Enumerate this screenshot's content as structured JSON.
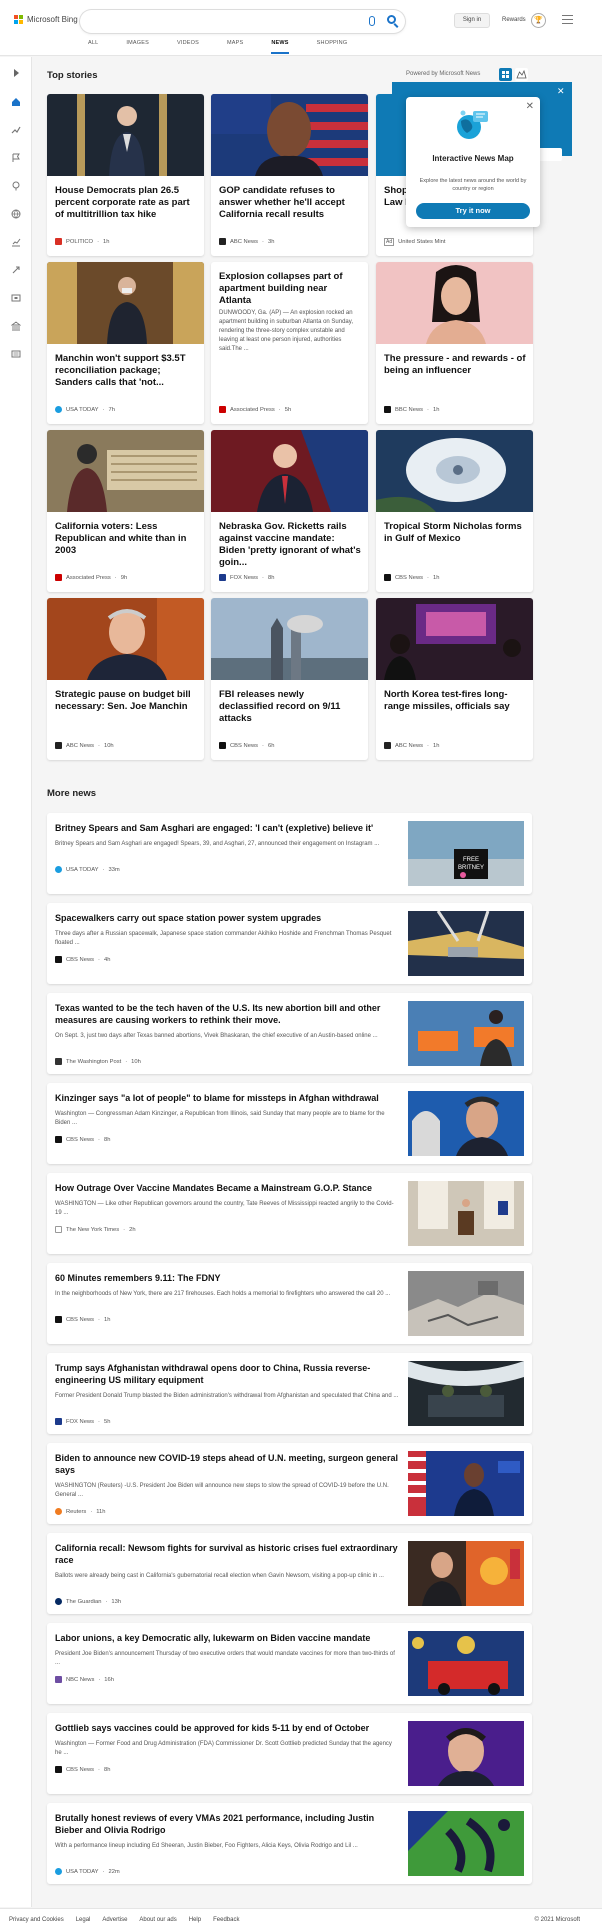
{
  "header": {
    "logo_text": "Microsoft Bing",
    "signin": "Sign in",
    "rewards": "Rewards"
  },
  "nav": [
    "ALL",
    "IMAGES",
    "VIDEOS",
    "MAPS",
    "NEWS",
    "SHOPPING"
  ],
  "nav_active": "NEWS",
  "top_stories": {
    "title": "Top stories",
    "powered": "Powered by Microsoft News",
    "cards": [
      {
        "title": "House Democrats plan 26.5 percent corporate rate as part of multitrillion tax hike",
        "source": "POLITICO",
        "time": "1h"
      },
      {
        "title": "GOP candidate refuses to answer whether he'll accept California recall results",
        "source": "ABC News",
        "time": "3h"
      },
      {
        "title": "Shop\nLaw I",
        "source": "United States Mint",
        "ad": "Ad"
      },
      {
        "title": "Manchin won't support $3.5T reconciliation package; Sanders calls that 'not...",
        "source": "USA TODAY",
        "time": "7h"
      },
      {
        "title": "Explosion collapses part of apartment building near Atlanta",
        "desc": "DUNWOODY, Ga. (AP) — An explosion rocked an apartment building in suburban Atlanta on Sunday, rendering the three-story complex unstable and leaving at least one person injured, authorities said.The ...",
        "source": "Associated Press",
        "time": "5h"
      },
      {
        "title": "The pressure - and rewards - of being an influencer",
        "source": "BBC News",
        "time": "1h"
      },
      {
        "title": "California voters: Less Republican and white than in 2003",
        "source": "Associated Press",
        "time": "9h"
      },
      {
        "title": "Nebraska Gov. Ricketts rails against vaccine mandate: Biden 'pretty ignorant of what's goin...",
        "source": "FOX News",
        "time": "8h"
      },
      {
        "title": "Tropical Storm Nicholas forms in Gulf of Mexico",
        "source": "CBS News",
        "time": "1h"
      },
      {
        "title": "Strategic pause on budget bill necessary: Sen. Joe Manchin",
        "source": "ABC News",
        "time": "10h"
      },
      {
        "title": "FBI releases newly declassified record on 9/11 attacks",
        "source": "CBS News",
        "time": "6h"
      },
      {
        "title": "North Korea test-fires long-range missiles, officials say",
        "source": "ABC News",
        "time": "1h"
      }
    ]
  },
  "popover": {
    "title": "Interactive News Map",
    "desc": "Explore the latest news around the world by country or region",
    "button": "Try it now",
    "close": "✕"
  },
  "more_news": {
    "title": "More news",
    "items": [
      {
        "title": "Britney Spears and Sam Asghari are engaged: 'I can't (expletive) believe it'",
        "desc": "Britney Spears and Sam Asghari are engaged! Spears, 39, and Asghari, 27, announced their engagement on Instagram ...",
        "source": "USA TODAY",
        "time": "33m"
      },
      {
        "title": "Spacewalkers carry out space station power system upgrades",
        "desc": "Three days after a Russian spacewalk, Japanese space station commander Akihiko Hoshide and Frenchman Thomas Pesquet floated ...",
        "source": "CBS News",
        "time": "4h"
      },
      {
        "title": "Texas wanted to be the tech haven of the U.S. Its new abortion bill and other measures are causing workers to rethink their move.",
        "desc": "On Sept. 3, just two days after Texas banned abortions, Vivek Bhaskaran, the chief executive of an Austin-based online ...",
        "source": "The Washington Post",
        "time": "10h"
      },
      {
        "title": "Kinzinger says \"a lot of people\" to blame for missteps in Afghan withdrawal",
        "desc": "Washington — Congressman Adam Kinzinger, a Republican from Illinois, said Sunday that many people are to blame for the Biden ...",
        "source": "CBS News",
        "time": "8h"
      },
      {
        "title": "How Outrage Over Vaccine Mandates Became a Mainstream G.O.P. Stance",
        "desc": "WASHINGTON — Like other Republican governors around the country, Tate Reeves of Mississippi reacted angrily to the Covid-19 ...",
        "source": "The New York Times",
        "time": "2h"
      },
      {
        "title": "60 Minutes remembers 9.11: The FDNY",
        "desc": "In the neighborhoods of New York, there are 217 firehouses. Each holds a memorial to firefighters who answered the call 20 ...",
        "source": "CBS News",
        "time": "1h"
      },
      {
        "title": "Trump says Afghanistan withdrawal opens door to China, Russia reverse-engineering US military equipment",
        "desc": "Former President Donald Trump blasted the Biden administration's withdrawal from Afghanistan and speculated that China and ...",
        "source": "FOX News",
        "time": "5h"
      },
      {
        "title": "Biden to announce new COVID-19 steps ahead of U.N. meeting, surgeon general says",
        "desc": "WASHINGTON (Reuters) -U.S. President Joe Biden will announce new steps to slow the spread of COVID-19 before the U.N. General ...",
        "source": "Reuters",
        "time": "11h"
      },
      {
        "title": "California recall: Newsom fights for survival as historic crises fuel extraordinary race",
        "desc": "Ballots were already being cast in California's gubernatorial recall election when Gavin Newsom, visiting a pop-up clinic in ...",
        "source": "The Guardian",
        "time": "13h"
      },
      {
        "title": "Labor unions, a key Democratic ally, lukewarm on Biden vaccine mandate",
        "desc": "President Joe Biden's announcement Thursday of two executive orders that would mandate vaccines for more than two-thirds of ...",
        "source": "NBC News",
        "time": "16h"
      },
      {
        "title": "Gottlieb says vaccines could be approved for kids 5-11 by end of October",
        "desc": "Washington — Former Food and Drug Administration (FDA) Commissioner Dr. Scott Gottlieb predicted Sunday that the agency he ...",
        "source": "CBS News",
        "time": "8h"
      },
      {
        "title": "Brutally honest reviews of every VMAs 2021 performance, including Justin Bieber and Olivia Rodrigo",
        "desc": "With a performance lineup including Ed Sheeran, Justin Bieber, Foo Fighters, Alicia Keys, Olivia Rodrigo and Lil ...",
        "source": "USA TODAY",
        "time": "22m"
      }
    ]
  },
  "footer": {
    "links": [
      "Privacy and Cookies",
      "Legal",
      "Advertise",
      "About our ads",
      "Help",
      "Feedback"
    ],
    "copyright": "© 2021 Microsoft"
  },
  "colors": {
    "accent": "#0f7ab5",
    "link_blue": "#1a73c9"
  }
}
